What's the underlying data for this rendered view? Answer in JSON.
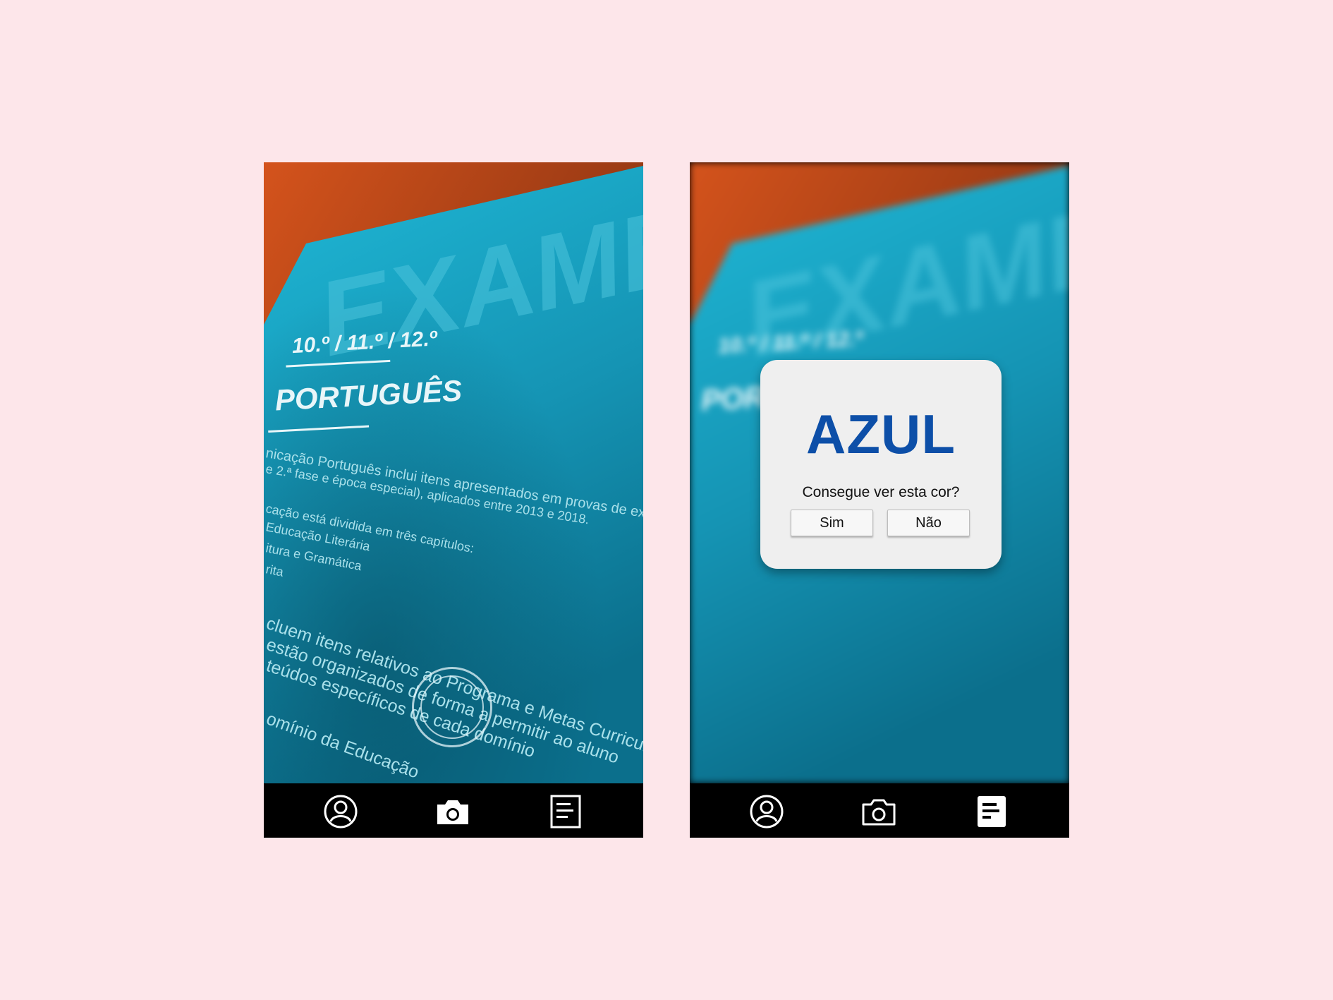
{
  "screens": [
    {
      "id": "camera",
      "poster": {
        "headline": "EXAME",
        "grades": "10.º / 11.º / 12.º",
        "subject": "PORTUGUÊS",
        "body_lines": [
          "nicação Português inclui itens apresentados em provas de exames",
          "e 2.ª fase e época especial), aplicados entre 2013 e 2018.",
          "cação está dividida em três capítulos:",
          "Educação Literária",
          "itura e Gramática",
          "rita",
          "cluem itens relativos ao Programa e Metas Curriculares",
          "estão organizados de forma a permitir ao aluno",
          "teúdos específicos de cada domínio",
          "omínio da Educação"
        ]
      },
      "nav": [
        "profile-icon",
        "camera-icon",
        "document-icon"
      ]
    },
    {
      "id": "color-check",
      "poster": {
        "headline": "EXAME",
        "grades": "10.º / 11.º / 12.º",
        "subject": "PORTUGUÊS"
      },
      "dialog": {
        "color_name": "AZUL",
        "color_hex": "#0d4fa8",
        "question": "Consegue ver esta cor?",
        "yes_label": "Sim",
        "no_label": "Não"
      },
      "nav": [
        "profile-icon",
        "camera-icon",
        "document-filled-icon"
      ]
    }
  ],
  "colors": {
    "background": "#fde6ea",
    "poster_cyan": "#1aa6c4",
    "table_wood": "#b8451a",
    "nav_bar": "#000000"
  }
}
